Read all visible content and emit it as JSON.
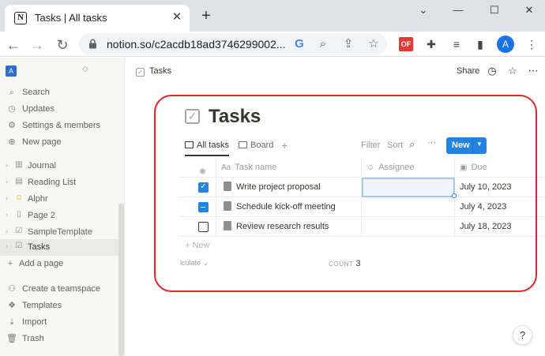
{
  "browser": {
    "tab_title": "Tasks | All tasks",
    "favicon_letter": "N",
    "new_tab_symbol": "+",
    "url": "notion.so/c2acdb18ad3746299002...",
    "pdf_extension_label": "OF",
    "profile_initial": "A"
  },
  "sidebar": {
    "workspace_initial": "A",
    "top_items": [
      {
        "label": "Search",
        "icon": "search-icon"
      },
      {
        "label": "Updates",
        "icon": "clock-icon"
      },
      {
        "label": "Settings & members",
        "icon": "gear-icon"
      },
      {
        "label": "New page",
        "icon": "plus-circle-icon"
      }
    ],
    "pages": [
      {
        "label": "Journal",
        "icon": "book-icon"
      },
      {
        "label": "Reading List",
        "icon": "list-icon"
      },
      {
        "label": "Alphr",
        "icon": "emoji-icon"
      },
      {
        "label": "Page 2",
        "icon": "page-icon"
      },
      {
        "label": "SampleTemplate",
        "icon": "checkbox-icon"
      },
      {
        "label": "Tasks",
        "icon": "checkbox-icon",
        "active": true
      }
    ],
    "add_page": "Add a page",
    "bottom_items": [
      {
        "label": "Create a teamspace",
        "icon": "people-icon"
      },
      {
        "label": "Templates",
        "icon": "templates-icon"
      },
      {
        "label": "Import",
        "icon": "download-icon"
      },
      {
        "label": "Trash",
        "icon": "trash-icon"
      }
    ]
  },
  "topbar": {
    "breadcrumb": "Tasks",
    "share": "Share"
  },
  "page": {
    "title": "Tasks"
  },
  "views": {
    "tabs": [
      {
        "label": "All tasks",
        "active": true
      },
      {
        "label": "Board",
        "active": false
      }
    ],
    "add": "+",
    "filter": "Filter",
    "sort": "Sort",
    "more": "···",
    "new_button": "New"
  },
  "table": {
    "columns": [
      {
        "label": "Task name",
        "icon_text": "Aa"
      },
      {
        "label": "Assignee",
        "icon_text": "☺"
      },
      {
        "label": "Due",
        "icon_text": "▣"
      }
    ],
    "rows": [
      {
        "task": "Write project proposal",
        "assignee": "",
        "due": "July 10, 2023",
        "status": "checked"
      },
      {
        "task": "Schedule kick-off meeting",
        "assignee": "",
        "due": "July 4, 2023",
        "status": "mixed"
      },
      {
        "task": "Review research results",
        "assignee": "",
        "due": "July 18, 2023",
        "status": "unchecked"
      }
    ],
    "new_row": "+ New",
    "calculate": "lculate ⌄",
    "count_label": "COUNT",
    "count_value": "3"
  },
  "help_button": "?",
  "colors": {
    "accent": "#2383e2",
    "highlight": "#e0262b",
    "profile": "#1a73e8",
    "pdf_badge": "#e53935"
  }
}
